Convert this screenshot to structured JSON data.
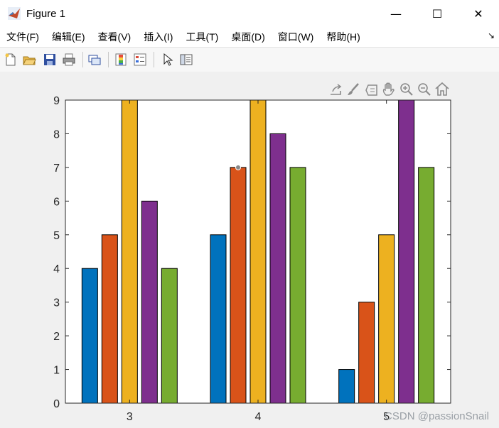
{
  "window": {
    "title": "Figure 1",
    "minimize": "—",
    "maximize": "☐",
    "close": "✕"
  },
  "menu": {
    "items": [
      "文件(F)",
      "编辑(E)",
      "查看(V)",
      "插入(I)",
      "工具(T)",
      "桌面(D)",
      "窗口(W)",
      "帮助(H)"
    ],
    "overflow": "↘"
  },
  "toolbar_icons": [
    "new-figure-icon",
    "open-file-icon",
    "save-icon",
    "print-icon",
    "link-plot-icon",
    "colorbar-icon",
    "legend-icon",
    "pointer-icon",
    "property-inspector-icon"
  ],
  "axes_toolbar_icons": [
    "export-icon",
    "brush-icon",
    "data-tips-icon",
    "pan-icon",
    "zoom-in-icon",
    "zoom-out-icon",
    "home-icon"
  ],
  "watermark": "CSDN @passionSnail",
  "colors": {
    "series": [
      "#0072bd",
      "#d95319",
      "#edb120",
      "#7e2f8e",
      "#77ac30"
    ],
    "axes_bg": "#ffffff",
    "figure_bg": "#f0f0f0"
  },
  "chart_data": {
    "type": "bar",
    "categories": [
      "3",
      "4",
      "5"
    ],
    "series": [
      {
        "values": [
          4,
          5,
          1
        ]
      },
      {
        "values": [
          5,
          7,
          3
        ]
      },
      {
        "values": [
          9,
          9,
          5
        ]
      },
      {
        "values": [
          6,
          8,
          9
        ]
      },
      {
        "values": [
          4,
          7,
          7
        ]
      }
    ],
    "ylim": [
      0,
      9
    ],
    "yticks": [
      0,
      1,
      2,
      3,
      4,
      5,
      6,
      7,
      8,
      9
    ],
    "xlabel": "",
    "ylabel": "",
    "title": "",
    "grid": false,
    "datatip": {
      "category": "4",
      "series": 1,
      "value": 7
    }
  }
}
